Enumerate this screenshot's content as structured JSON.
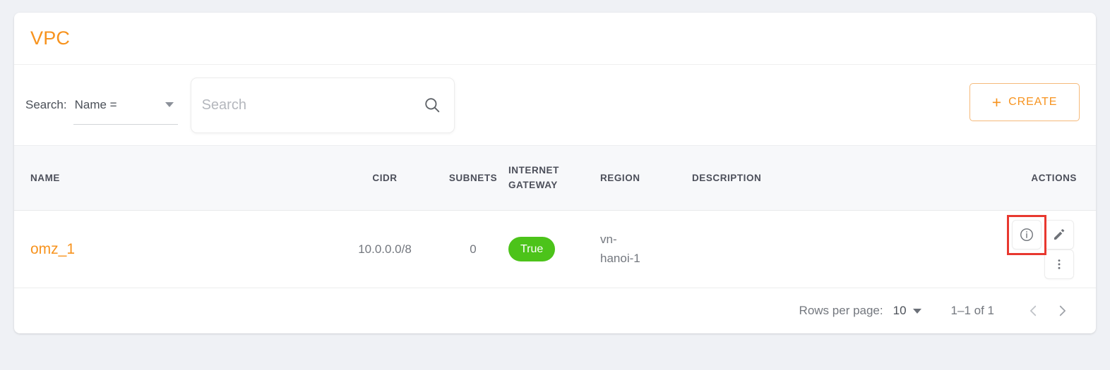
{
  "page": {
    "title": "VPC",
    "accent_color": "#f7931e",
    "background_color": "#eff1f5"
  },
  "toolbar": {
    "search_label": "Search:",
    "field_select_value": "Name =",
    "field_select_icon": "chevron-down-icon",
    "search_placeholder": "Search",
    "search_value": "",
    "search_icon": "search-icon",
    "create_plus": "+",
    "create_label": "CREATE"
  },
  "table": {
    "columns": [
      {
        "key": "name",
        "label": "NAME"
      },
      {
        "key": "cidr",
        "label": "CIDR"
      },
      {
        "key": "subnets",
        "label": "SUBNETS"
      },
      {
        "key": "igw_line1",
        "label": "INTERNET"
      },
      {
        "key": "igw_line2",
        "label": "GATEWAY"
      },
      {
        "key": "region",
        "label": "REGION"
      },
      {
        "key": "description",
        "label": "DESCRIPTION"
      },
      {
        "key": "actions",
        "label": "ACTIONS"
      }
    ],
    "rows": [
      {
        "name": "omz_1",
        "cidr": "10.0.0.0/8",
        "subnets": "0",
        "internet_gateway": "True",
        "internet_gateway_color": "#4cc31a",
        "region_line1": "vn-",
        "region_line2": "hanoi-1",
        "description": "",
        "actions": {
          "info_icon": "info-circle-icon",
          "edit_icon": "pencil-icon",
          "more_icon": "more-vertical-icon",
          "highlighted": "info"
        }
      }
    ]
  },
  "footer": {
    "rows_per_page_label": "Rows per page:",
    "rows_per_page_value": "10",
    "rows_per_page_icon": "chevron-down-icon",
    "range_text": "1–1 of 1",
    "prev_icon": "chevron-left-icon",
    "next_icon": "chevron-right-icon"
  },
  "annotation": {
    "highlight_color": "#e8382f"
  }
}
